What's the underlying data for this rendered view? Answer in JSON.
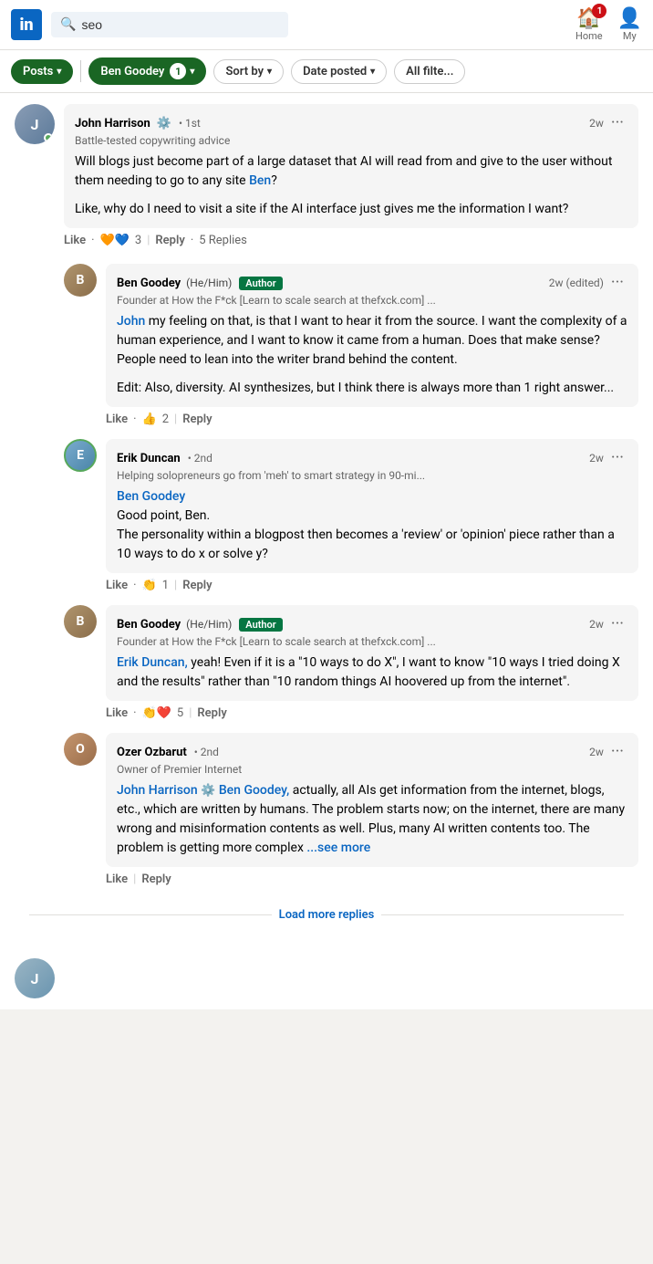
{
  "header": {
    "logo": "in",
    "search_placeholder": "seo",
    "search_value": "seo",
    "home_label": "Home",
    "my_label": "My",
    "notification_count": "1"
  },
  "filter_bar": {
    "posts_label": "Posts",
    "ben_goodey_label": "Ben Goodey",
    "ben_goodey_count": "1",
    "sort_by_label": "Sort by",
    "date_posted_label": "Date posted",
    "all_filters_label": "All filte..."
  },
  "post": {
    "author": "John Harrison",
    "degree": "1st",
    "time": "2w",
    "subtitle": "Battle-tested copywriting advice",
    "text1": "Will blogs just become part of a large dataset that AI will read from and give to the user without them needing to go to any site ",
    "mention_ben": "Ben",
    "text1_end": "?",
    "text2": "Like, why do I need to visit a site if the AI interface just gives me the information I want?",
    "reactions_count": "3",
    "reply_label": "Reply",
    "replies_count": "5 Replies"
  },
  "replies": [
    {
      "name": "Ben Goodey",
      "pronouns": "(He/Him)",
      "is_author": true,
      "author_label": "Author",
      "degree": "",
      "time": "2w (edited)",
      "subtitle": "Founder at How the F*ck [Learn to scale search at thefxck.com] ...",
      "mention": "John",
      "text": "my feeling on that, is that I want to hear it from the source. I want the complexity of a human experience, and I want to know it came from a human. Does that make sense? People need to lean into the writer brand behind the content.",
      "text2": "Edit: Also, diversity. AI synthesizes, but I think there is always more than 1 right answer...",
      "reactions_count": "2",
      "reaction_type": "thumbs",
      "reply_label": "Reply"
    },
    {
      "name": "Erik Duncan",
      "pronouns": "",
      "is_author": false,
      "degree": "2nd",
      "time": "2w",
      "subtitle": "Helping solopreneurs go from 'meh' to smart strategy in 90-mi...",
      "mention": "Ben Goodey",
      "text": "Good point, Ben.\nThe personality within a blogpost then becomes a 'review' or 'opinion' piece rather than a 10 ways to do x or solve y?",
      "reactions_count": "1",
      "reaction_type": "clap",
      "reply_label": "Reply"
    },
    {
      "name": "Ben Goodey",
      "pronouns": "(He/Him)",
      "is_author": true,
      "author_label": "Author",
      "degree": "",
      "time": "2w",
      "subtitle": "Founder at How the F*ck [Learn to scale search at thefxck.com] ...",
      "mention": "Erik Duncan,",
      "text": "yeah! Even if it is a \"10 ways to do X\", I want to know \"10 ways I tried doing X and the results\" rather than \"10 random things AI hoovered up from the internet\".",
      "reactions_count": "5",
      "reaction_type": "clap_heart",
      "reply_label": "Reply"
    },
    {
      "name": "Ozer Ozbarut",
      "pronouns": "",
      "is_author": false,
      "degree": "2nd",
      "time": "2w",
      "subtitle": "Owner of Premier Internet",
      "mention1": "John Harrison",
      "mention2": "Ben Goodey,",
      "text": "actually, all AIs get information from the internet, blogs, etc., which are written by humans. The problem starts now; on the internet, there are many wrong and misinformation contents as well. Plus, many AI written contents too. The problem is getting more complex",
      "see_more": "...see more",
      "like_label": "Like",
      "reply_label": "Reply"
    }
  ],
  "load_more": {
    "label": "Load more replies"
  },
  "bottom_partial": {
    "initial": "J"
  },
  "actions": {
    "like_label": "Like",
    "reply_label": "Reply"
  }
}
